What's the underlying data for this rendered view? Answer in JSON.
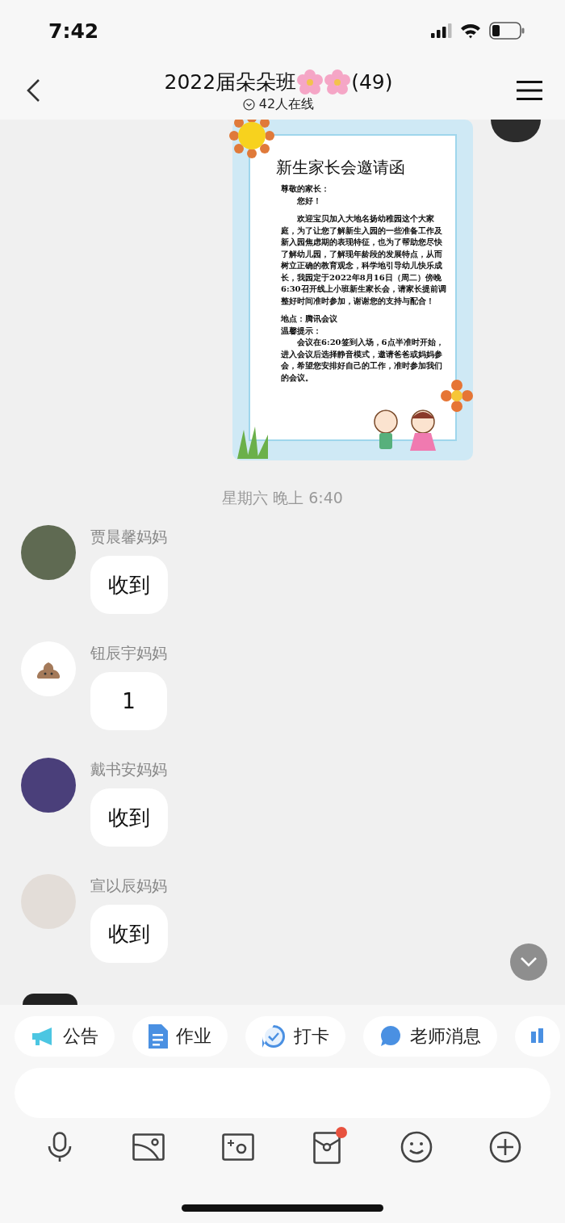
{
  "status_bar": {
    "time": "7:42"
  },
  "header": {
    "title": "2022届朵朵班",
    "count": "(49)",
    "online": "42人在线"
  },
  "invitation": {
    "heading": "新生家长会邀请函",
    "paragraphs": [
      {
        "text": "尊敬的家长：",
        "kind": "label"
      },
      {
        "text": "您好！",
        "kind": "body"
      },
      {
        "text": "欢迎宝贝加入大地名扬幼稚园这个大家庭，为了让您了解新生入园的一些准备工作及新入园焦虑期的表现特征，也为了帮助您尽快了解幼儿园，了解现年龄段的发展特点，从而树立正确的教育观念，科学地引导幼儿快乐成长，我园定于2022年8月16日（周二）傍晚6:30召开线上小班新生家长会，请家长提前调整好时间准时参加，谢谢您的支持与配合！",
        "kind": "body"
      },
      {
        "text": "地点：腾讯会议",
        "kind": "label"
      },
      {
        "text": "温馨提示：",
        "kind": "label"
      },
      {
        "text": "会议在6:20签到入场，6点半准时开始，进入会议后选择静音模式，邀请爸爸或妈妈参会，希望您安排好自己的工作，准时参加我们的会议。",
        "kind": "body"
      }
    ]
  },
  "timestamp": "星期六 晚上 6:40",
  "messages": [
    {
      "sender": "贾晨馨妈妈",
      "text": "收到",
      "kind": "photo",
      "color": "#5f6a52"
    },
    {
      "sender": "钮辰宇妈妈",
      "text": "1",
      "kind": "emoji",
      "color": "#ffffff"
    },
    {
      "sender": "戴书安妈妈",
      "text": "收到",
      "kind": "photo",
      "color": "#4a3f7a"
    },
    {
      "sender": "宣以辰妈妈",
      "text": "收到",
      "kind": "photo",
      "color": "#e3ddd8"
    }
  ],
  "quick_actions": [
    {
      "kind": "megaphone",
      "label": "公告"
    },
    {
      "kind": "document",
      "label": "作业"
    },
    {
      "kind": "check",
      "label": "打卡"
    },
    {
      "kind": "teacher",
      "label": "老师消息"
    },
    {
      "kind": "bars"
    }
  ],
  "toolbar": [
    {
      "kind": "mic",
      "notification": false
    },
    {
      "kind": "image",
      "notification": false
    },
    {
      "kind": "camera",
      "notification": false
    },
    {
      "kind": "redpacket",
      "notification": true
    },
    {
      "kind": "emoji",
      "notification": false
    },
    {
      "kind": "plus",
      "notification": false
    }
  ]
}
